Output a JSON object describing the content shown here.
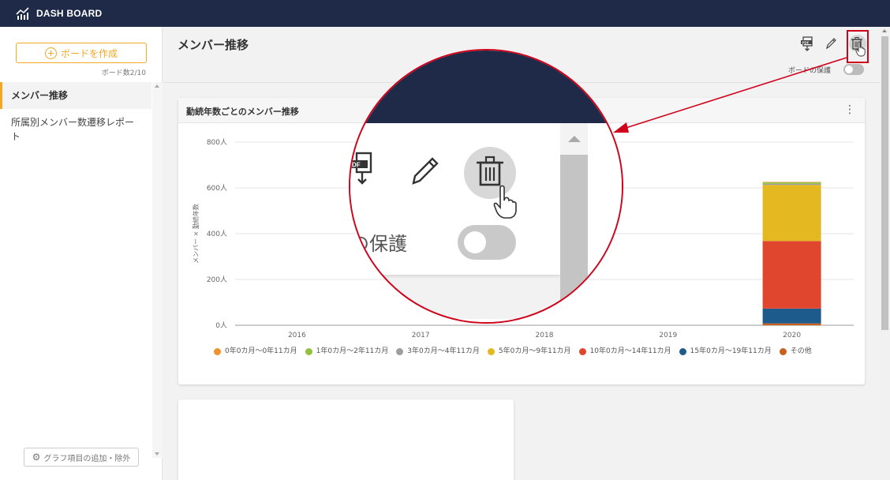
{
  "header": {
    "title": "DASH BOARD"
  },
  "sidebar": {
    "create_button": "ボードを作成",
    "board_count": "ボード数2/10",
    "items": [
      {
        "label": "メンバー推移",
        "active": true
      },
      {
        "label": "所属別メンバー数遷移レポート",
        "active": false
      }
    ],
    "graph_button": "グラフ項目の追加・除外"
  },
  "main": {
    "title": "メンバー推移",
    "toolbar": {
      "pdf_icon": "pdf-download-icon",
      "edit_icon": "pencil-icon",
      "delete_icon": "trash-icon",
      "protect_label": "ボードの保護",
      "protect_enabled": false
    }
  },
  "zoom": {
    "protect_label_fragment": "の保護"
  },
  "chart_data": {
    "type": "bar",
    "stacked": true,
    "title": "勤続年数ごとのメンバー推移",
    "ylabel": "メンバー × 勤続年数",
    "ylim": [
      0,
      800
    ],
    "yticks": [
      "0人",
      "200人",
      "400人",
      "600人",
      "800人"
    ],
    "categories": [
      "2016",
      "2017",
      "2018",
      "2019",
      "2020"
    ],
    "series": [
      {
        "name": "0年0カ月〜0年11カ月",
        "color": "#f0922e",
        "values": [
          0,
          0,
          0,
          0,
          2
        ]
      },
      {
        "name": "1年0カ月〜2年11カ月",
        "color": "#93c13e",
        "values": [
          0,
          0,
          0,
          0,
          6
        ]
      },
      {
        "name": "3年0カ月〜4年11カ月",
        "color": "#9e9e9e",
        "values": [
          0,
          0,
          0,
          0,
          5
        ]
      },
      {
        "name": "5年0カ月〜9年11カ月",
        "color": "#e4b820",
        "values": [
          0,
          0,
          0,
          0,
          245
        ]
      },
      {
        "name": "10年0カ月〜14年11カ月",
        "color": "#e0452d",
        "values": [
          0,
          0,
          0,
          0,
          295
        ]
      },
      {
        "name": "15年0カ月〜19年11カ月",
        "color": "#1d5b8c",
        "values": [
          0,
          0,
          0,
          0,
          65
        ]
      },
      {
        "name": "その他",
        "color": "#c9601b",
        "values": [
          0,
          0,
          0,
          0,
          8
        ]
      }
    ],
    "stack_order": [
      6,
      5,
      4,
      3,
      2,
      1,
      0
    ],
    "grid": true,
    "legend_position": "bottom"
  }
}
